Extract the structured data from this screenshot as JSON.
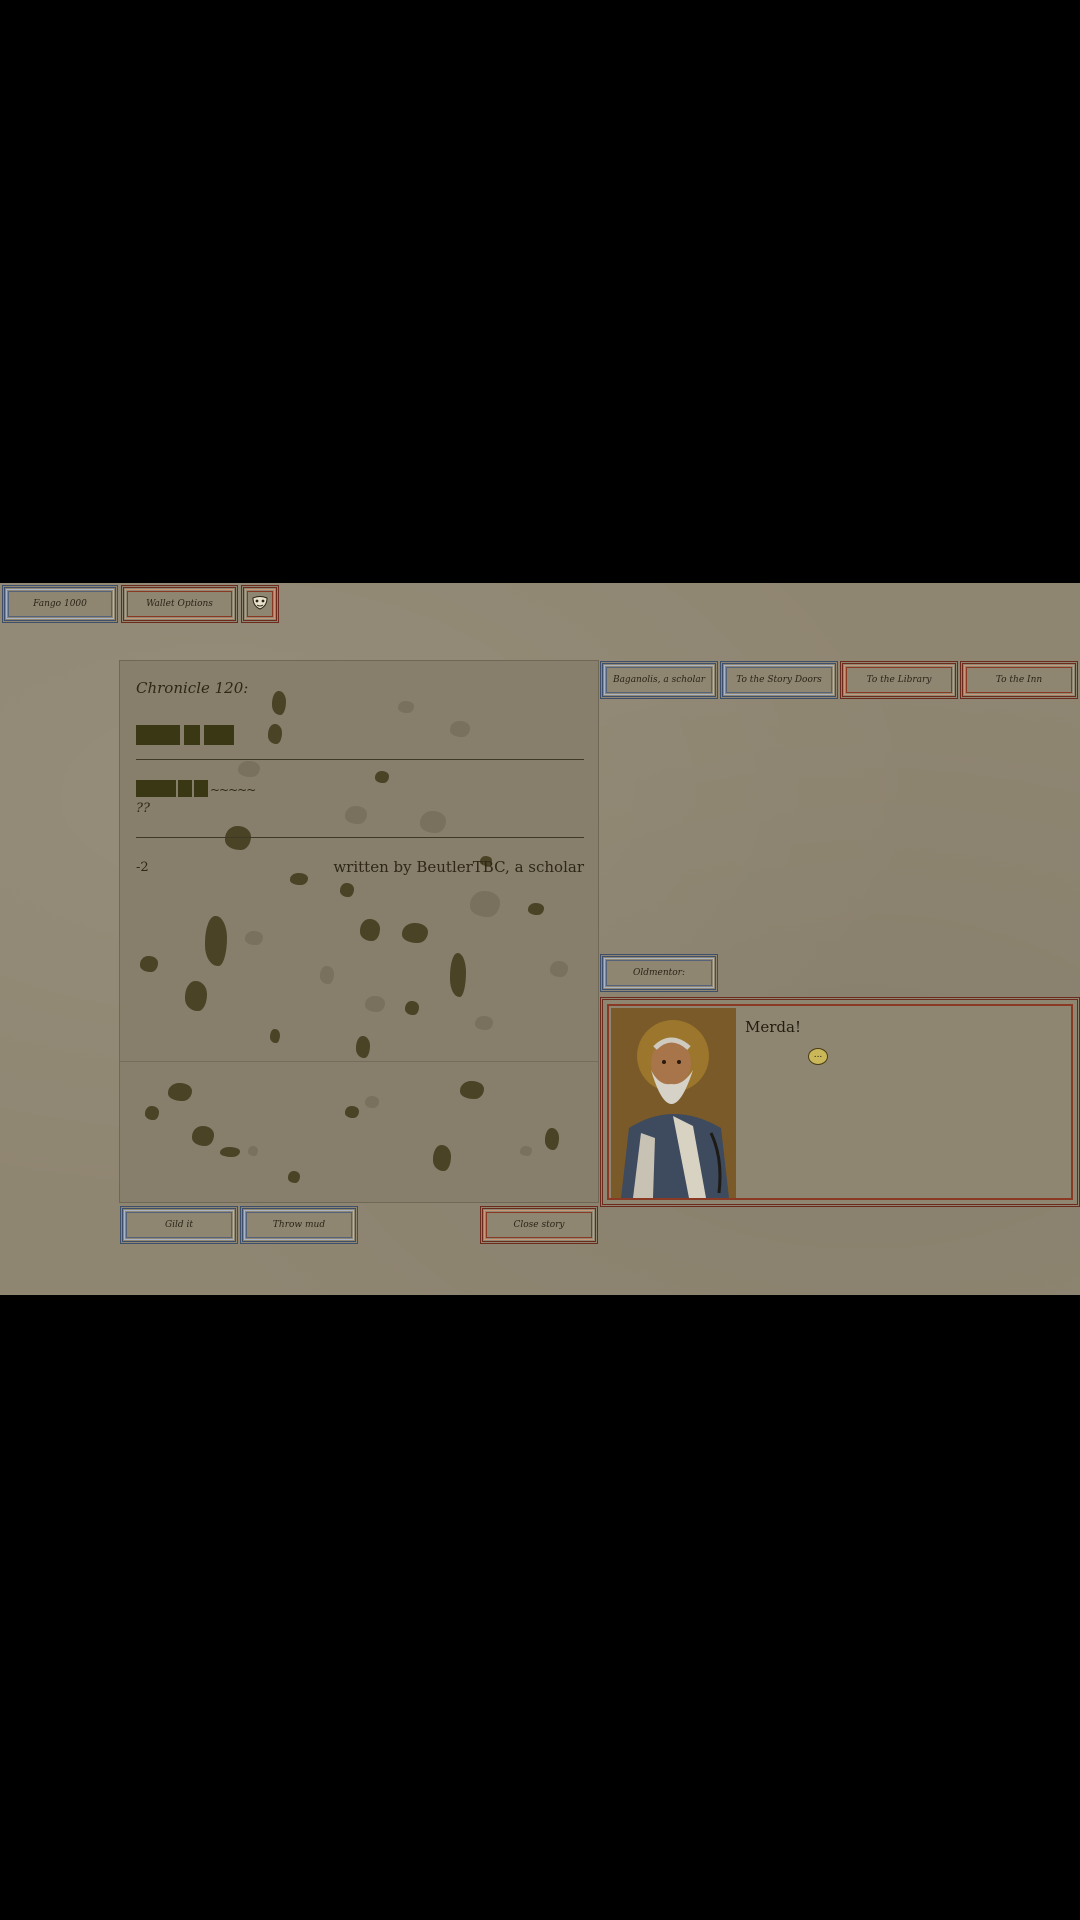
{
  "top_bar": {
    "fango_label": "Fango 1000",
    "wallet_label": "Wallet Options",
    "mask_icon": "theatre-mask-icon"
  },
  "nav": {
    "scholar_label": "Baganolis, a scholar",
    "story_doors_label": "To the Story Doors",
    "library_label": "To the Library",
    "inn_label": "To the Inn"
  },
  "story": {
    "title": "Chronicle 120:",
    "question": "??",
    "number": "-2",
    "byline": "written by BeutlerTBC, a scholar",
    "squiggle": "~~~~~"
  },
  "story_actions": {
    "gild_label": "Gild it",
    "mud_label": "Throw mud",
    "close_label": "Close story"
  },
  "dialog": {
    "speaker_label": "Oldmentor:",
    "line": "Merda!",
    "bubble_icon": "speech-bubble-icon",
    "bubble_text": "..."
  },
  "colors": {
    "background": "#8f8672",
    "frame_blue": "#3d4f6a",
    "frame_red": "#6b2a1c",
    "redaction": "#3a3714"
  }
}
